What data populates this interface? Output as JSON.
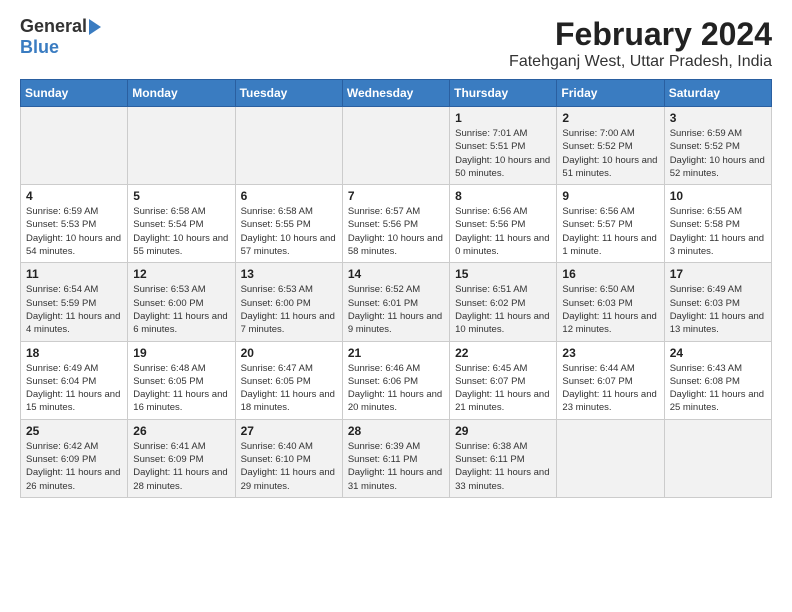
{
  "logo": {
    "general": "General",
    "blue": "Blue"
  },
  "title": "February 2024",
  "subtitle": "Fatehganj West, Uttar Pradesh, India",
  "headers": [
    "Sunday",
    "Monday",
    "Tuesday",
    "Wednesday",
    "Thursday",
    "Friday",
    "Saturday"
  ],
  "weeks": [
    [
      {
        "day": "",
        "info": ""
      },
      {
        "day": "",
        "info": ""
      },
      {
        "day": "",
        "info": ""
      },
      {
        "day": "",
        "info": ""
      },
      {
        "day": "1",
        "info": "Sunrise: 7:01 AM\nSunset: 5:51 PM\nDaylight: 10 hours\nand 50 minutes."
      },
      {
        "day": "2",
        "info": "Sunrise: 7:00 AM\nSunset: 5:52 PM\nDaylight: 10 hours\nand 51 minutes."
      },
      {
        "day": "3",
        "info": "Sunrise: 6:59 AM\nSunset: 5:52 PM\nDaylight: 10 hours\nand 52 minutes."
      }
    ],
    [
      {
        "day": "4",
        "info": "Sunrise: 6:59 AM\nSunset: 5:53 PM\nDaylight: 10 hours\nand 54 minutes."
      },
      {
        "day": "5",
        "info": "Sunrise: 6:58 AM\nSunset: 5:54 PM\nDaylight: 10 hours\nand 55 minutes."
      },
      {
        "day": "6",
        "info": "Sunrise: 6:58 AM\nSunset: 5:55 PM\nDaylight: 10 hours\nand 57 minutes."
      },
      {
        "day": "7",
        "info": "Sunrise: 6:57 AM\nSunset: 5:56 PM\nDaylight: 10 hours\nand 58 minutes."
      },
      {
        "day": "8",
        "info": "Sunrise: 6:56 AM\nSunset: 5:56 PM\nDaylight: 11 hours\nand 0 minutes."
      },
      {
        "day": "9",
        "info": "Sunrise: 6:56 AM\nSunset: 5:57 PM\nDaylight: 11 hours\nand 1 minute."
      },
      {
        "day": "10",
        "info": "Sunrise: 6:55 AM\nSunset: 5:58 PM\nDaylight: 11 hours\nand 3 minutes."
      }
    ],
    [
      {
        "day": "11",
        "info": "Sunrise: 6:54 AM\nSunset: 5:59 PM\nDaylight: 11 hours\nand 4 minutes."
      },
      {
        "day": "12",
        "info": "Sunrise: 6:53 AM\nSunset: 6:00 PM\nDaylight: 11 hours\nand 6 minutes."
      },
      {
        "day": "13",
        "info": "Sunrise: 6:53 AM\nSunset: 6:00 PM\nDaylight: 11 hours\nand 7 minutes."
      },
      {
        "day": "14",
        "info": "Sunrise: 6:52 AM\nSunset: 6:01 PM\nDaylight: 11 hours\nand 9 minutes."
      },
      {
        "day": "15",
        "info": "Sunrise: 6:51 AM\nSunset: 6:02 PM\nDaylight: 11 hours\nand 10 minutes."
      },
      {
        "day": "16",
        "info": "Sunrise: 6:50 AM\nSunset: 6:03 PM\nDaylight: 11 hours\nand 12 minutes."
      },
      {
        "day": "17",
        "info": "Sunrise: 6:49 AM\nSunset: 6:03 PM\nDaylight: 11 hours\nand 13 minutes."
      }
    ],
    [
      {
        "day": "18",
        "info": "Sunrise: 6:49 AM\nSunset: 6:04 PM\nDaylight: 11 hours\nand 15 minutes."
      },
      {
        "day": "19",
        "info": "Sunrise: 6:48 AM\nSunset: 6:05 PM\nDaylight: 11 hours\nand 16 minutes."
      },
      {
        "day": "20",
        "info": "Sunrise: 6:47 AM\nSunset: 6:05 PM\nDaylight: 11 hours\nand 18 minutes."
      },
      {
        "day": "21",
        "info": "Sunrise: 6:46 AM\nSunset: 6:06 PM\nDaylight: 11 hours\nand 20 minutes."
      },
      {
        "day": "22",
        "info": "Sunrise: 6:45 AM\nSunset: 6:07 PM\nDaylight: 11 hours\nand 21 minutes."
      },
      {
        "day": "23",
        "info": "Sunrise: 6:44 AM\nSunset: 6:07 PM\nDaylight: 11 hours\nand 23 minutes."
      },
      {
        "day": "24",
        "info": "Sunrise: 6:43 AM\nSunset: 6:08 PM\nDaylight: 11 hours\nand 25 minutes."
      }
    ],
    [
      {
        "day": "25",
        "info": "Sunrise: 6:42 AM\nSunset: 6:09 PM\nDaylight: 11 hours\nand 26 minutes."
      },
      {
        "day": "26",
        "info": "Sunrise: 6:41 AM\nSunset: 6:09 PM\nDaylight: 11 hours\nand 28 minutes."
      },
      {
        "day": "27",
        "info": "Sunrise: 6:40 AM\nSunset: 6:10 PM\nDaylight: 11 hours\nand 29 minutes."
      },
      {
        "day": "28",
        "info": "Sunrise: 6:39 AM\nSunset: 6:11 PM\nDaylight: 11 hours\nand 31 minutes."
      },
      {
        "day": "29",
        "info": "Sunrise: 6:38 AM\nSunset: 6:11 PM\nDaylight: 11 hours\nand 33 minutes."
      },
      {
        "day": "",
        "info": ""
      },
      {
        "day": "",
        "info": ""
      }
    ]
  ]
}
